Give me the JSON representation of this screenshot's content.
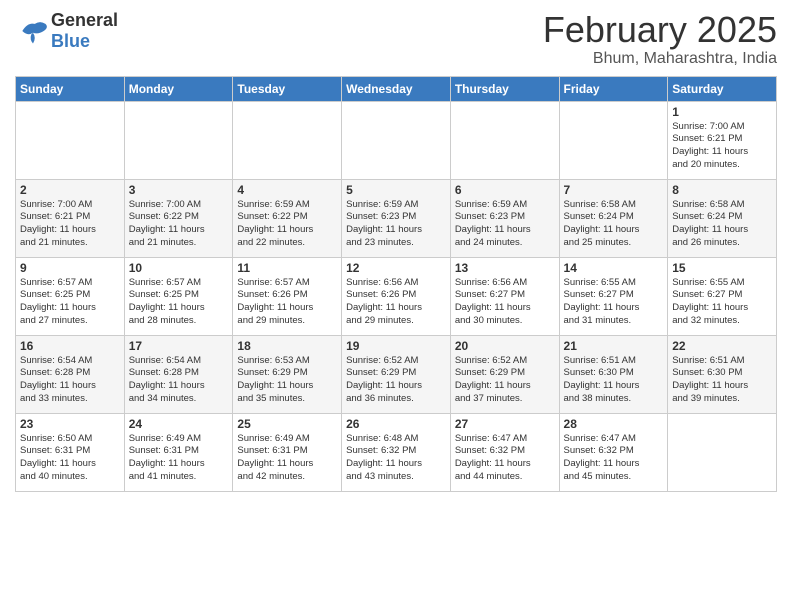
{
  "header": {
    "logo_general": "General",
    "logo_blue": "Blue",
    "month_title": "February 2025",
    "location": "Bhum, Maharashtra, India"
  },
  "weekdays": [
    "Sunday",
    "Monday",
    "Tuesday",
    "Wednesday",
    "Thursday",
    "Friday",
    "Saturday"
  ],
  "weeks": [
    [
      {
        "day": "",
        "info": ""
      },
      {
        "day": "",
        "info": ""
      },
      {
        "day": "",
        "info": ""
      },
      {
        "day": "",
        "info": ""
      },
      {
        "day": "",
        "info": ""
      },
      {
        "day": "",
        "info": ""
      },
      {
        "day": "1",
        "info": "Sunrise: 7:00 AM\nSunset: 6:21 PM\nDaylight: 11 hours\nand 20 minutes."
      }
    ],
    [
      {
        "day": "2",
        "info": "Sunrise: 7:00 AM\nSunset: 6:21 PM\nDaylight: 11 hours\nand 21 minutes."
      },
      {
        "day": "3",
        "info": "Sunrise: 7:00 AM\nSunset: 6:22 PM\nDaylight: 11 hours\nand 21 minutes."
      },
      {
        "day": "4",
        "info": "Sunrise: 6:59 AM\nSunset: 6:22 PM\nDaylight: 11 hours\nand 22 minutes."
      },
      {
        "day": "5",
        "info": "Sunrise: 6:59 AM\nSunset: 6:23 PM\nDaylight: 11 hours\nand 23 minutes."
      },
      {
        "day": "6",
        "info": "Sunrise: 6:59 AM\nSunset: 6:23 PM\nDaylight: 11 hours\nand 24 minutes."
      },
      {
        "day": "7",
        "info": "Sunrise: 6:58 AM\nSunset: 6:24 PM\nDaylight: 11 hours\nand 25 minutes."
      },
      {
        "day": "8",
        "info": "Sunrise: 6:58 AM\nSunset: 6:24 PM\nDaylight: 11 hours\nand 26 minutes."
      }
    ],
    [
      {
        "day": "9",
        "info": "Sunrise: 6:57 AM\nSunset: 6:25 PM\nDaylight: 11 hours\nand 27 minutes."
      },
      {
        "day": "10",
        "info": "Sunrise: 6:57 AM\nSunset: 6:25 PM\nDaylight: 11 hours\nand 28 minutes."
      },
      {
        "day": "11",
        "info": "Sunrise: 6:57 AM\nSunset: 6:26 PM\nDaylight: 11 hours\nand 29 minutes."
      },
      {
        "day": "12",
        "info": "Sunrise: 6:56 AM\nSunset: 6:26 PM\nDaylight: 11 hours\nand 29 minutes."
      },
      {
        "day": "13",
        "info": "Sunrise: 6:56 AM\nSunset: 6:27 PM\nDaylight: 11 hours\nand 30 minutes."
      },
      {
        "day": "14",
        "info": "Sunrise: 6:55 AM\nSunset: 6:27 PM\nDaylight: 11 hours\nand 31 minutes."
      },
      {
        "day": "15",
        "info": "Sunrise: 6:55 AM\nSunset: 6:27 PM\nDaylight: 11 hours\nand 32 minutes."
      }
    ],
    [
      {
        "day": "16",
        "info": "Sunrise: 6:54 AM\nSunset: 6:28 PM\nDaylight: 11 hours\nand 33 minutes."
      },
      {
        "day": "17",
        "info": "Sunrise: 6:54 AM\nSunset: 6:28 PM\nDaylight: 11 hours\nand 34 minutes."
      },
      {
        "day": "18",
        "info": "Sunrise: 6:53 AM\nSunset: 6:29 PM\nDaylight: 11 hours\nand 35 minutes."
      },
      {
        "day": "19",
        "info": "Sunrise: 6:52 AM\nSunset: 6:29 PM\nDaylight: 11 hours\nand 36 minutes."
      },
      {
        "day": "20",
        "info": "Sunrise: 6:52 AM\nSunset: 6:29 PM\nDaylight: 11 hours\nand 37 minutes."
      },
      {
        "day": "21",
        "info": "Sunrise: 6:51 AM\nSunset: 6:30 PM\nDaylight: 11 hours\nand 38 minutes."
      },
      {
        "day": "22",
        "info": "Sunrise: 6:51 AM\nSunset: 6:30 PM\nDaylight: 11 hours\nand 39 minutes."
      }
    ],
    [
      {
        "day": "23",
        "info": "Sunrise: 6:50 AM\nSunset: 6:31 PM\nDaylight: 11 hours\nand 40 minutes."
      },
      {
        "day": "24",
        "info": "Sunrise: 6:49 AM\nSunset: 6:31 PM\nDaylight: 11 hours\nand 41 minutes."
      },
      {
        "day": "25",
        "info": "Sunrise: 6:49 AM\nSunset: 6:31 PM\nDaylight: 11 hours\nand 42 minutes."
      },
      {
        "day": "26",
        "info": "Sunrise: 6:48 AM\nSunset: 6:32 PM\nDaylight: 11 hours\nand 43 minutes."
      },
      {
        "day": "27",
        "info": "Sunrise: 6:47 AM\nSunset: 6:32 PM\nDaylight: 11 hours\nand 44 minutes."
      },
      {
        "day": "28",
        "info": "Sunrise: 6:47 AM\nSunset: 6:32 PM\nDaylight: 11 hours\nand 45 minutes."
      },
      {
        "day": "",
        "info": ""
      }
    ]
  ]
}
